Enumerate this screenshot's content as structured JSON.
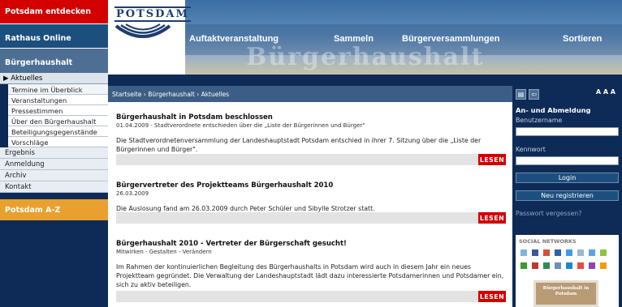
{
  "sidebar": {
    "top_red": "Potsdam entdecken",
    "top_blue": "Rathaus Online",
    "section": "Bürgerhaushalt",
    "active_item": "▶ Aktuelles",
    "sub_items": [
      "Termine im Überblick",
      "Veranstaltungen",
      "Pressestimmen",
      "Über den Bürgerhaushalt",
      "Beteiligungsgegenstände",
      "Vorschläge"
    ],
    "main_items": [
      "Ergebnis",
      "Anmeldung",
      "Archiv",
      "Kontakt"
    ],
    "az": "Potsdam A-Z"
  },
  "header": {
    "logo_text": "POTSDAM",
    "nav": [
      "Auftaktveranstaltung",
      "Sammeln",
      "Bürgerversammlungen",
      "Sortieren"
    ],
    "banner_text": "Bürgerhaushalt"
  },
  "breadcrumb": "Startseite › Bürgerhaushalt › Aktuelles",
  "articles": [
    {
      "title": "Bürgerhaushalt in Potsdam beschlossen",
      "meta": "01.04.2009 - Stadtverordnete entschieden über die „Liste der Bürgerinnen und Bürger\"",
      "body": "Die Stadtverordnetenversammlung der Landeshauptstadt Potsdam entschied in ihrer 7. Sitzung über die „Liste der Bürgerinnen und Bürger\".",
      "more": "LESEN"
    },
    {
      "title": "Bürgervertreter des Projektteams Bürgerhaushalt 2010",
      "meta": "26.03.2009",
      "body": "Die Auslosung fand am 26.03.2009 durch Peter Schüler und Sibylle Strotzer statt.",
      "more": "LESEN"
    },
    {
      "title": "Bürgerhaushalt 2010 - Vertreter der Bürgerschaft gesucht!",
      "meta": "Mitwirken - Gestalten - Verändern",
      "body": "Im Rahmen der kontinuierlichen Begleitung des Bürgerhaushalts in Potsdam wird auch in diesem Jahr ein neues Projektteam gegründet. Die Verwaltung der Landeshauptstadt lädt dazu interessierte Potsdamerinnen und Potsdamer ein, sich zu aktiv beteiligen.",
      "more": "LESEN"
    }
  ],
  "right": {
    "font_sizes": "A A A",
    "login_heading": "An- und Abmeldung",
    "username_label": "Benutzername",
    "password_label": "Kennwort",
    "login_button": "Login",
    "register_button": "Neu registrieren",
    "forgot_link": "Passwort vergessen?",
    "social_heading": "SOCIAL NETWORKS",
    "thumb_text": "Bürgerhaushalt in Potsdam"
  },
  "colors": {
    "navy": "#0e2a56",
    "red": "#d40000",
    "orange": "#e8a12e"
  }
}
